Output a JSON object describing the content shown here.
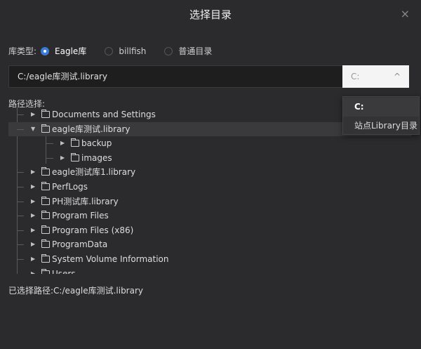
{
  "dialog": {
    "title": "选择目录",
    "close": "×"
  },
  "library_type": {
    "label": "库类型:",
    "options": [
      {
        "label": "Eagle库",
        "selected": true
      },
      {
        "label": "billfish",
        "selected": false
      },
      {
        "label": "普通目录",
        "selected": false
      }
    ]
  },
  "path": {
    "value": "C:/eagle库测试.library"
  },
  "drive": {
    "value": "C:",
    "chevron": "^"
  },
  "drive_options": [
    "C:",
    "站点Library目录"
  ],
  "tree_label": "路径选择:",
  "tree": [
    {
      "label": "Documents and Settings",
      "level": 0,
      "expanded": false
    },
    {
      "label": "eagle库测试.library",
      "level": 0,
      "expanded": true,
      "selected": true
    },
    {
      "label": "backup",
      "level": 1,
      "expanded": false
    },
    {
      "label": "images",
      "level": 1,
      "expanded": false
    },
    {
      "label": "eagle测试库1.library",
      "level": 0,
      "expanded": false
    },
    {
      "label": "PerfLogs",
      "level": 0,
      "expanded": false
    },
    {
      "label": "PH测试库.library",
      "level": 0,
      "expanded": false
    },
    {
      "label": "Program Files",
      "level": 0,
      "expanded": false
    },
    {
      "label": "Program Files (x86)",
      "level": 0,
      "expanded": false
    },
    {
      "label": "ProgramData",
      "level": 0,
      "expanded": false
    },
    {
      "label": "System Volume Information",
      "level": 0,
      "expanded": false
    },
    {
      "label": "Users",
      "level": 0,
      "expanded": false
    }
  ],
  "selected_path": {
    "label": "已选择路径:",
    "value": "C:/eagle库测试.library"
  },
  "colors": {
    "accent": "#3a7bd5",
    "background": "#2b2b2d"
  }
}
